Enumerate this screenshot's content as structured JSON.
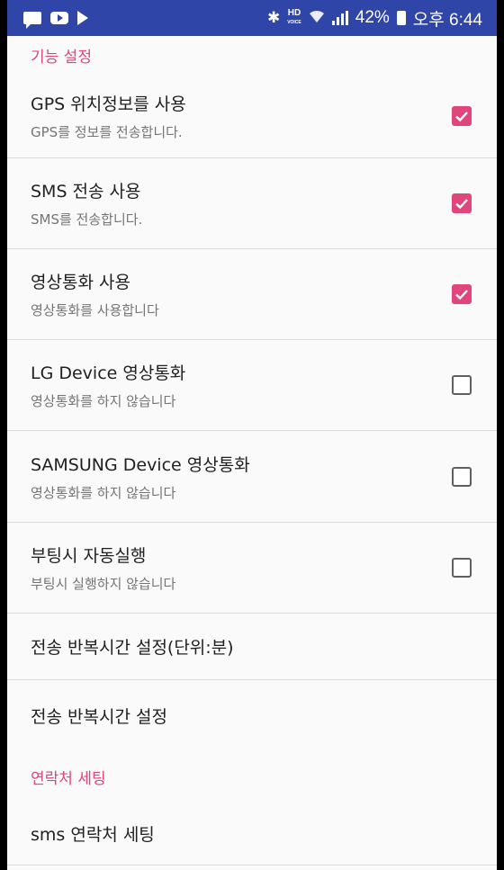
{
  "status_bar": {
    "battery": "42%",
    "time": "오후 6:44",
    "hd_label": "HD",
    "hd_sub": "VOICE",
    "icons": [
      "message-icon",
      "youtube-icon",
      "play-store-icon",
      "bluetooth-icon",
      "hd-voice-icon",
      "wifi-icon",
      "signal-icon",
      "battery-icon"
    ]
  },
  "sections": {
    "feature_settings": "기능 설정",
    "contact_settings": "연락처 세팅"
  },
  "prefs": [
    {
      "title": "GPS 위치정보를 사용",
      "summary": "GPS를 정보를 전송합니다.",
      "checked": true
    },
    {
      "title": "SMS 전송 사용",
      "summary": "SMS를 전송합니다.",
      "checked": true
    },
    {
      "title": "영상통화 사용",
      "summary": "영상통화를 사용합니다",
      "checked": true
    },
    {
      "title": "LG Device 영상통화",
      "summary": "영상통화를 하지 않습니다",
      "checked": false
    },
    {
      "title": "SAMSUNG Device 영상통화",
      "summary": "영상통화를 하지 않습니다",
      "checked": false
    },
    {
      "title": "부팅시 자동실행",
      "summary": "부팅시 실행하지 않습니다",
      "checked": false
    }
  ],
  "simple_items": {
    "interval_unit": "전송 반복시간 설정(단위:분)",
    "interval": "전송 반복시간 설정",
    "sms_contacts": "sms 연락처 세팅"
  },
  "colors": {
    "status_bar": "#2f46a8",
    "accent": "#e0457b"
  }
}
